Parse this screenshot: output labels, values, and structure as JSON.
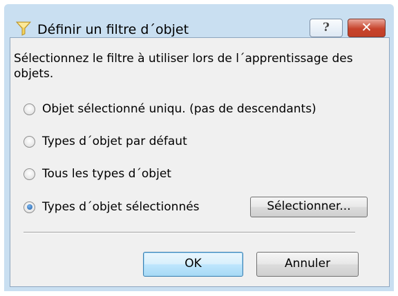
{
  "window": {
    "title": "Définir un filtre d´objet",
    "help_label": "?",
    "close_label": "✕"
  },
  "instruction": "Sélectionnez le filtre à utiliser lors de l´apprentissage des objets.",
  "options": [
    {
      "label": "Objet sélectionné uniqu. (pas de descendants)",
      "selected": false
    },
    {
      "label": "Types d´objet par défaut",
      "selected": false
    },
    {
      "label": "Tous les types d´objet",
      "selected": false
    },
    {
      "label": "Types d´objet sélectionnés",
      "selected": true
    }
  ],
  "select_button_label": "Sélectionner...",
  "ok_label": "OK",
  "cancel_label": "Annuler",
  "colors": {
    "title_bar": "#c9dff1",
    "dialog_bg": "#f0f0f0",
    "close_button": "#c7432c",
    "default_button": "#bee6fd"
  }
}
